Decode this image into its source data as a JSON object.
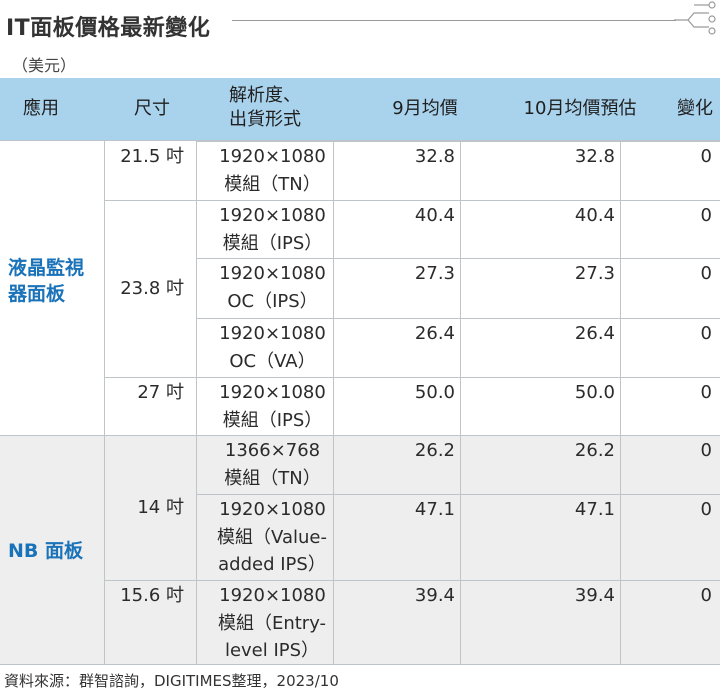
{
  "title": "IT面板價格最新變化",
  "unit": "（美元）",
  "source": "資料來源：群智諮詢，DIGITIMES整理，2023/10",
  "colors": {
    "header": "#a9d2ec",
    "app_text": "#1a72b8",
    "nb_band": "#eeeeee"
  },
  "chart_data": {
    "type": "table",
    "columns": [
      "應用",
      "尺寸",
      "解析度、\n出貨形式",
      "9月均價",
      "10月均價預估",
      "變化"
    ],
    "groups": [
      {
        "application": "液晶監視器面板",
        "rows": [
          {
            "size": "21.5 吋",
            "res": "1920×1080",
            "form": "模組（TN）",
            "sep": 32.8,
            "oct": 32.8,
            "change": 0
          },
          {
            "size": "23.8 吋",
            "res": "1920×1080",
            "form": "模組（IPS）",
            "sep": 40.4,
            "oct": 40.4,
            "change": 0
          },
          {
            "size": "23.8 吋",
            "res": "1920×1080",
            "form": "OC（IPS）",
            "sep": 27.3,
            "oct": 27.3,
            "change": 0
          },
          {
            "size": "23.8 吋",
            "res": "1920×1080",
            "form": "OC（VA）",
            "sep": 26.4,
            "oct": 26.4,
            "change": 0
          },
          {
            "size": "27 吋",
            "res": "1920×1080",
            "form": "模組（IPS）",
            "sep": 50.0,
            "oct": 50.0,
            "change": 0
          }
        ]
      },
      {
        "application": "NB 面板",
        "rows": [
          {
            "size": "14 吋",
            "res": "1366×768",
            "form": "模組（TN）",
            "sep": 26.2,
            "oct": 26.2,
            "change": 0
          },
          {
            "size": "14 吋",
            "res": "1920×1080",
            "form": "模組（Value-added IPS）",
            "sep": 47.1,
            "oct": 47.1,
            "change": 0
          },
          {
            "size": "15.6 吋",
            "res": "1920×1080",
            "form": "模組（Entry-level IPS）",
            "sep": 39.4,
            "oct": 39.4,
            "change": 0
          }
        ]
      }
    ]
  }
}
